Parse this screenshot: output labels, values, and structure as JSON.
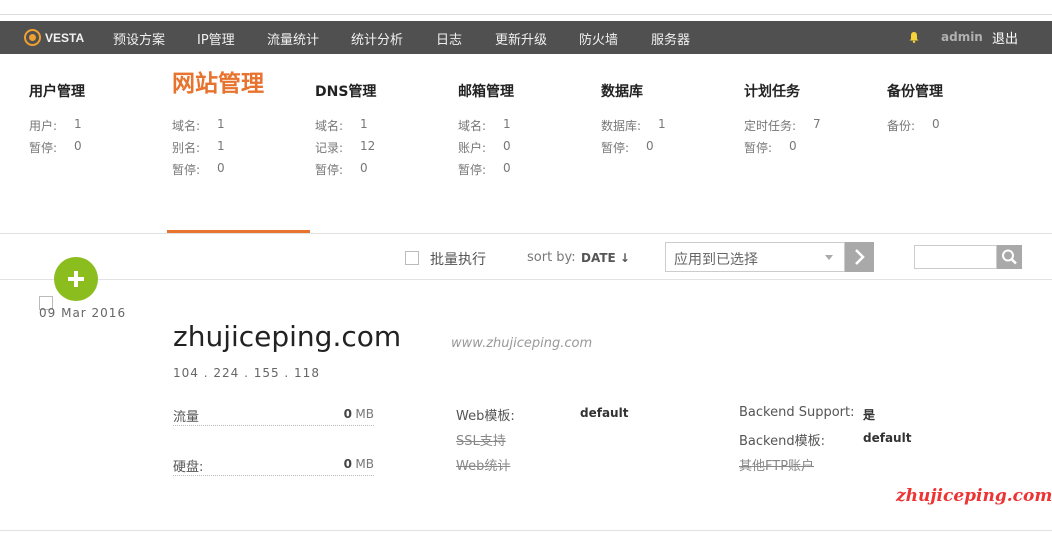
{
  "nav": {
    "logo": "VESTA",
    "items": [
      "预设方案",
      "IP管理",
      "流量统计",
      "统计分析",
      "日志",
      "更新升级",
      "防火墙",
      "服务器"
    ],
    "user": "admin",
    "logout": "退出"
  },
  "stats": [
    {
      "title": "用户管理",
      "rows": [
        {
          "label": "用户:",
          "value": "1"
        },
        {
          "label": "暂停:",
          "value": "0"
        }
      ]
    },
    {
      "title": "网站管理",
      "active": true,
      "rows": [
        {
          "label": "域名:",
          "value": "1"
        },
        {
          "label": "别名:",
          "value": "1"
        },
        {
          "label": "暂停:",
          "value": "0"
        }
      ]
    },
    {
      "title": "DNS管理",
      "rows": [
        {
          "label": "域名:",
          "value": "1"
        },
        {
          "label": "记录:",
          "value": "12"
        },
        {
          "label": "暂停:",
          "value": "0"
        }
      ]
    },
    {
      "title": "邮箱管理",
      "rows": [
        {
          "label": "域名:",
          "value": "1"
        },
        {
          "label": "账户:",
          "value": "0"
        },
        {
          "label": "暂停:",
          "value": "0"
        }
      ]
    },
    {
      "title": "数据库",
      "rows": [
        {
          "label": "数据库:",
          "value": "1"
        },
        {
          "label": "暂停:",
          "value": "0"
        }
      ]
    },
    {
      "title": "计划任务",
      "rows": [
        {
          "label": "定时任务:",
          "value": "7"
        },
        {
          "label": "暂停:",
          "value": "0"
        }
      ]
    },
    {
      "title": "备份管理",
      "rows": [
        {
          "label": "备份:",
          "value": "0"
        }
      ]
    }
  ],
  "toolbar": {
    "bulk_label": "批量执行",
    "sort_label": "sort by:",
    "sort_value": "DATE ↓",
    "select_placeholder": "应用到已选择"
  },
  "record": {
    "date": "09  Mar  2016",
    "domain": "zhujiceping.com",
    "alias": "www.zhujiceping.com",
    "ip": "104 . 224 . 155 . 118",
    "bandwidth_label": "流量",
    "bandwidth_value": "0",
    "bandwidth_unit": "MB",
    "disk_label": "硬盘:",
    "disk_value": "0",
    "disk_unit": "MB",
    "web_template_label": "Web模板:",
    "web_template_value": "default",
    "ssl_label": "SSL支持",
    "web_stats_label": "Web统计",
    "backend_support_label": "Backend Support:",
    "backend_support_value": "是",
    "backend_template_label": "Backend模板:",
    "backend_template_value": "default",
    "ftp_label": "其他FTP账户"
  },
  "watermark": "zhujiceping.com",
  "colors": {
    "accent": "#e8732e",
    "nav_bg": "#505050",
    "add_button": "#8cbd1f"
  }
}
